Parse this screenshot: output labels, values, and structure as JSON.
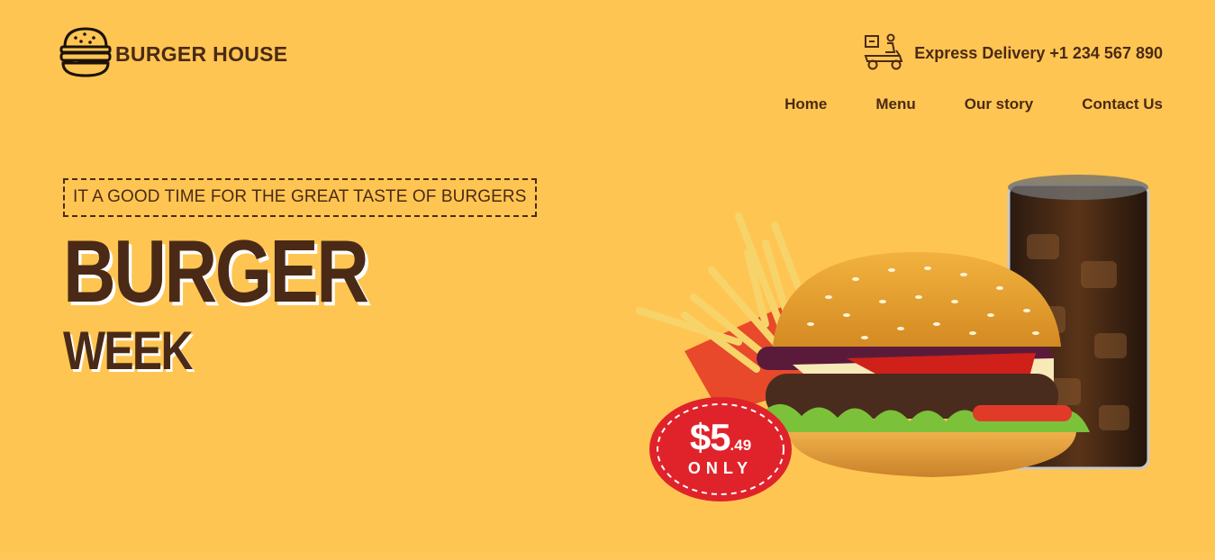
{
  "header": {
    "brand": "BURGER HOUSE",
    "delivery_text": "Express Delivery +1 234 567 890"
  },
  "nav": {
    "items": [
      {
        "label": "Home"
      },
      {
        "label": "Menu"
      },
      {
        "label": "Our story"
      },
      {
        "label": "Contact Us"
      }
    ]
  },
  "hero": {
    "tagline": "IT A GOOD TIME FOR THE GREAT TASTE OF BURGERS",
    "headline_line1": "BURGER",
    "headline_line2": "WEEK",
    "price_dollars": "$5",
    "price_cents": ".49",
    "price_note": "ONLY"
  },
  "colors": {
    "background": "#FFC552",
    "text": "#4a2a16",
    "price_badge": "#E0232A"
  },
  "icons": {
    "logo": "burger-icon",
    "delivery": "delivery-scooter-icon"
  }
}
